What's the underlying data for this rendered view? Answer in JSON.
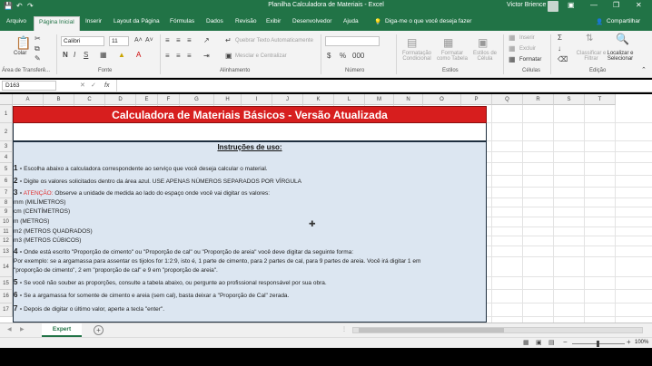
{
  "window": {
    "title": "Planilha Calculadora de Materiais  -  Excel",
    "user": "Victor Brience",
    "share_label": "Compartilhar",
    "tell_me": "Diga-me o que você deseja fazer"
  },
  "tabs": [
    "Arquivo",
    "Página Inicial",
    "Inserir",
    "Layout da Página",
    "Fórmulas",
    "Dados",
    "Revisão",
    "Exibir",
    "Desenvolvedor",
    "Ajuda"
  ],
  "ribbon": {
    "clipboard": {
      "paste": "Colar",
      "label": "Área de Transferê..."
    },
    "font": {
      "name": "Calibri",
      "size": "11",
      "label": "Fonte"
    },
    "alignment": {
      "wrap": "Quebrar Texto Automaticamente",
      "merge": "Mesclar e Centralizar",
      "label": "Alinhamento"
    },
    "number": {
      "label": "Número"
    },
    "styles": {
      "cond": "Formatação Condicional",
      "table": "Formatar como Tabela",
      "cell": "Estilos de Célula",
      "label": "Estilos"
    },
    "cells": {
      "insert": "Inserir",
      "delete": "Excluir",
      "format": "Formatar",
      "label": "Células"
    },
    "editing": {
      "sort": "Classificar e Filtrar",
      "find": "Localizar e Selecionar",
      "label": "Edição"
    }
  },
  "formula_bar": {
    "name_box": "D163",
    "fx": "fx",
    "content": ""
  },
  "columns": [
    "A",
    "B",
    "C",
    "D",
    "E",
    "F",
    "G",
    "H",
    "I",
    "J",
    "K",
    "L",
    "M",
    "N",
    "O",
    "P",
    "Q",
    "R",
    "S",
    "T"
  ],
  "rows": [
    "1",
    "2",
    "3",
    "4",
    "5",
    "6",
    "7",
    "8",
    "9",
    "10",
    "11",
    "12",
    "13",
    "14",
    "15",
    "16",
    "17"
  ],
  "sheet": {
    "title": "Calculadora de Materiais Básicos - Versão Atualizada",
    "instructions_header": "Instruções de uso:",
    "lines": [
      {
        "num": "1 -",
        "text": " Escolha abaixo a calculadora correspondente ao serviço que você deseja calcular o material."
      },
      {
        "num": "2 -",
        "text": " Digite os valores solicitados dentro da área azul. USE APENAS NÚMEROS SEPARADOS POR VÍRGULA"
      },
      {
        "num": "3 -",
        "red": " ATENÇÃO:",
        "text": " Observe a unidade de medida ao lado do espaço onde você vai digitar os valores:"
      },
      {
        "text": "mm (MILÍMETROS)"
      },
      {
        "text": "cm (CENTÍMETROS)"
      },
      {
        "text": "m (METROS)"
      },
      {
        "text": "m2 (METROS QUADRADOS)"
      },
      {
        "text": "m3 (METROS CÚBICOS)"
      },
      {
        "num": "4 -",
        "text": " Onde está escrito \"Proporção de cimento\" ou \"Proporção de cal\" ou \"Proporção de areia\" você deve digitar da seguinte forma:"
      },
      {
        "text": "Por exemplo: se a argamassa para assentar os tijolos for 1:2:9, isto é, 1 parte de cimento, para 2 partes de cal, para 9 partes de areia. Você irá digitar 1 em"
      },
      {
        "text": "\"proporção de cimento\", 2 em \"proporção de cal\" e 9 em \"proporção de areia\"."
      },
      {
        "num": "5 -",
        "text": " Se você não souber as proporções, consulte a tabela abaixo, ou pergunte ao profissional responsável por sua obra."
      },
      {
        "num": "6 -",
        "text": " Se a argamassa for somente de cimento e areia (sem cal), basta deixar a \"Proporção de Cal\" zerada."
      },
      {
        "num": "7 -",
        "text": " Depois de digitar o último valor, aperte a tecla \"enter\"."
      }
    ]
  },
  "sheet_tabs": {
    "active": "Expert",
    "add": "+"
  },
  "status": {
    "zoom": "100%"
  },
  "colors": {
    "excel_green": "#217346",
    "title_red": "#d71e1e",
    "input_blue": "#dce6f1",
    "attention_red": "#e03030"
  }
}
